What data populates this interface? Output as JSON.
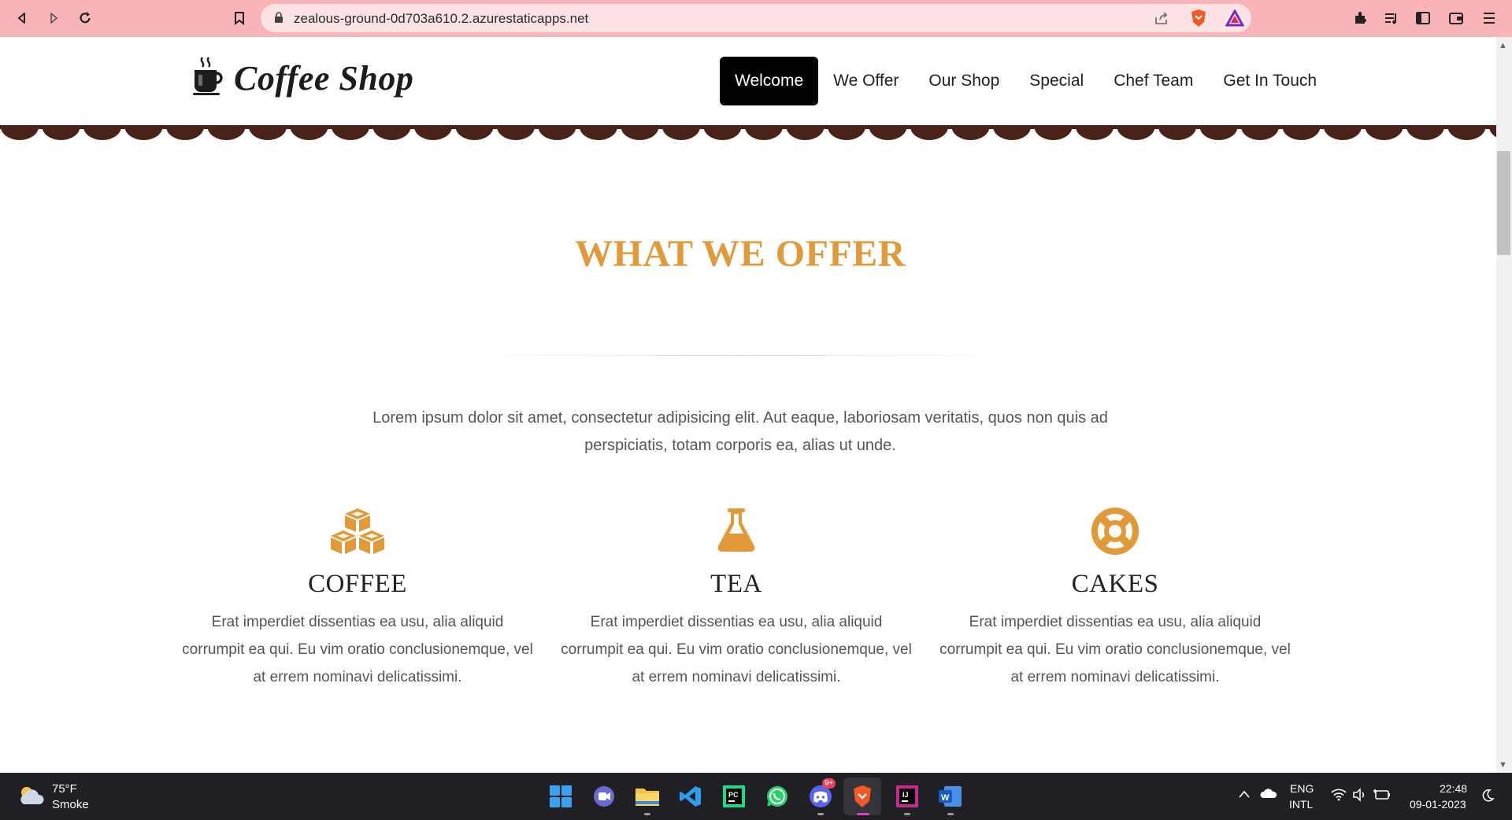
{
  "browser": {
    "url": "zealous-ground-0d703a610.2.azurestaticapps.net"
  },
  "site": {
    "logo_text": "Coffee Shop",
    "menu": [
      {
        "label": "Welcome",
        "active": true
      },
      {
        "label": "We Offer",
        "active": false
      },
      {
        "label": "Our Shop",
        "active": false
      },
      {
        "label": "Special",
        "active": false
      },
      {
        "label": "Chef Team",
        "active": false
      },
      {
        "label": "Get In Touch",
        "active": false
      }
    ]
  },
  "offer": {
    "title": "WHAT WE OFFER",
    "intro": "Lorem ipsum dolor sit amet, consectetur adipisicing elit. Aut eaque, laboriosam veritatis, quos non quis ad perspiciatis, totam corporis ea, alias ut unde.",
    "features": [
      {
        "name": "COFFEE",
        "icon": "cubes-icon",
        "desc": "Erat imperdiet dissentias ea usu, alia aliquid corrumpit ea qui. Eu vim oratio conclusionemque, vel at errem nominavi delicatissimi."
      },
      {
        "name": "TEA",
        "icon": "flask-icon",
        "desc": "Erat imperdiet dissentias ea usu, alia aliquid corrumpit ea qui. Eu vim oratio conclusionemque, vel at errem nominavi delicatissimi."
      },
      {
        "name": "CAKES",
        "icon": "life-ring-icon",
        "desc": "Erat imperdiet dissentias ea usu, alia aliquid corrumpit ea qui. Eu vim oratio conclusionemque, vel at errem nominavi delicatissimi."
      }
    ],
    "accent_color": "#e09a3a"
  },
  "taskbar": {
    "weather_temp": "75°F",
    "weather_desc": "Smoke",
    "lang_top": "ENG",
    "lang_bottom": "INTL",
    "time": "22:48",
    "date": "09-01-2023",
    "discord_badge": "9+"
  },
  "colors": {
    "chrome_bg": "#f8b4b8",
    "scallop": "#4a2218"
  }
}
